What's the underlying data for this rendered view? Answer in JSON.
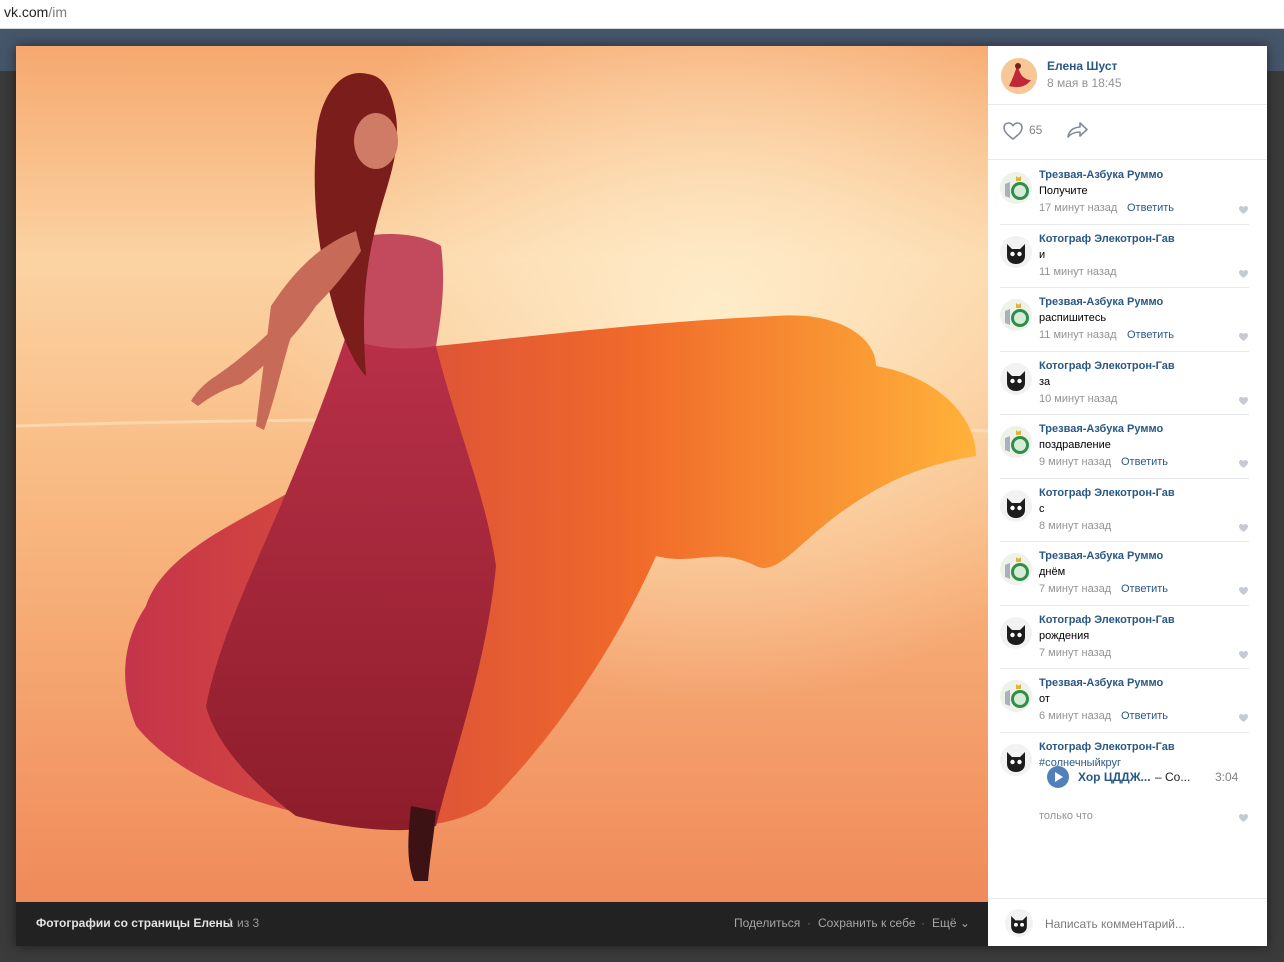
{
  "browser": {
    "url_host": "vk.com",
    "url_path": "/im"
  },
  "photo_footer": {
    "album_title": "Фотографии со страницы Елены",
    "counter": "1 из 3",
    "share_label": "Поделиться",
    "save_label": "Сохранить к себе",
    "more_label": "Ещё"
  },
  "post": {
    "author": "Елена Шуст",
    "date": "8 мая в 18:45",
    "likes": "65"
  },
  "comments": [
    {
      "author": "Трезвая-Азбука Руммо",
      "text": "Получите",
      "time": "17 минут назад",
      "reply": "Ответить",
      "avatar": "tea-cup"
    },
    {
      "author": "Котограф Элекотрон-Гав",
      "text": "и",
      "time": "11 минут назад",
      "reply": "",
      "avatar": "cat"
    },
    {
      "author": "Трезвая-Азбука Руммо",
      "text": "распишитесь",
      "time": "11 минут назад",
      "reply": "Ответить",
      "avatar": "tea-cup"
    },
    {
      "author": "Котограф Элекотрон-Гав",
      "text": "за",
      "time": "10 минут назад",
      "reply": "",
      "avatar": "cat"
    },
    {
      "author": "Трезвая-Азбука Руммо",
      "text": "поздравление",
      "time": "9 минут назад",
      "reply": "Ответить",
      "avatar": "tea-cup"
    },
    {
      "author": "Котограф Элекотрон-Гав",
      "text": "с",
      "time": "8 минут назад",
      "reply": "",
      "avatar": "cat"
    },
    {
      "author": "Трезвая-Азбука Руммо",
      "text": "днём",
      "time": "7 минут назад",
      "reply": "Ответить",
      "avatar": "tea-cup"
    },
    {
      "author": "Котограф Элекотрон-Гав",
      "text": "рождения",
      "time": "7 минут назад",
      "reply": "",
      "avatar": "cat"
    },
    {
      "author": "Трезвая-Азбука Руммо",
      "text": "от",
      "time": "6 минут назад",
      "reply": "Ответить",
      "avatar": "tea-cup"
    },
    {
      "author": "Котограф Элекотрон-Гав",
      "text": "#солнечныйкруг",
      "time": "только что",
      "reply": "",
      "avatar": "cat",
      "audio": {
        "title": "Хор ЦДДЖ...",
        "artist": "– Со...",
        "duration": "3:04"
      }
    }
  ],
  "reply_box": {
    "placeholder": "Написать комментарий..."
  },
  "colors": {
    "link": "#2a5885",
    "accent": "#5181b8",
    "muted": "#939393"
  }
}
